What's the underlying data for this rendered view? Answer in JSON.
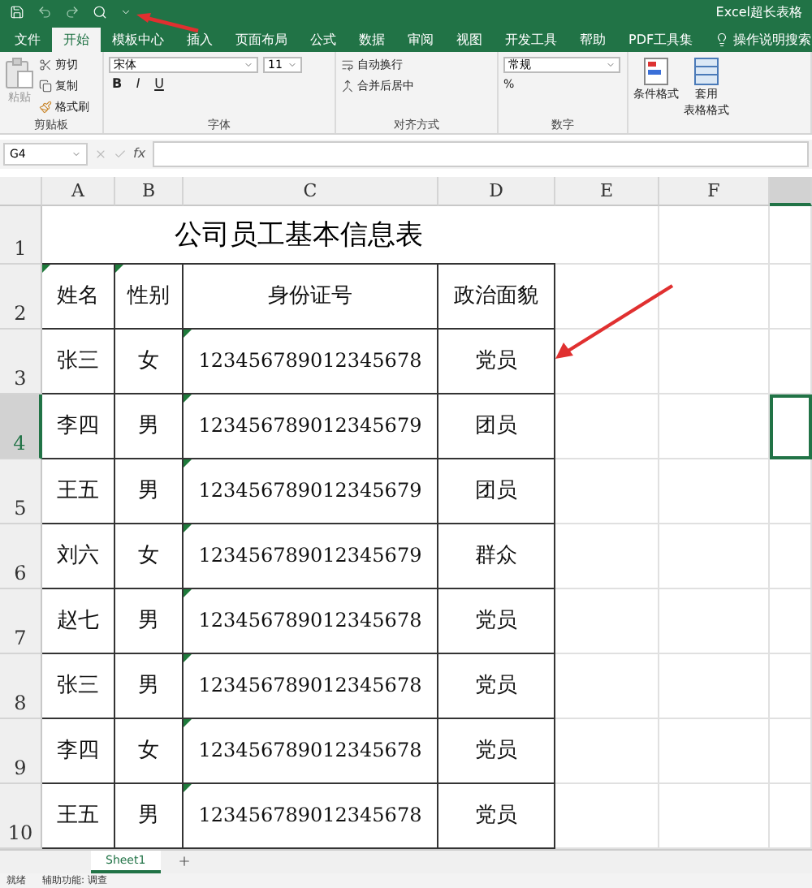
{
  "title_bar": {
    "title": "Excel超长表格"
  },
  "ribbon_tabs": [
    {
      "label": "文件",
      "selected": false
    },
    {
      "label": "开始",
      "selected": true
    },
    {
      "label": "模板中心",
      "selected": false
    },
    {
      "label": "插入",
      "selected": false
    },
    {
      "label": "页面布局",
      "selected": false
    },
    {
      "label": "公式",
      "selected": false
    },
    {
      "label": "数据",
      "selected": false
    },
    {
      "label": "审阅",
      "selected": false
    },
    {
      "label": "视图",
      "selected": false
    },
    {
      "label": "开发工具",
      "selected": false
    },
    {
      "label": "帮助",
      "selected": false
    },
    {
      "label": "PDF工具集",
      "selected": false
    }
  ],
  "tell_me": {
    "label": "操作说明搜索"
  },
  "ribbon": {
    "clipboard": {
      "label": "剪贴板",
      "paste": "粘贴",
      "paste_disabled": true,
      "cut": "剪切",
      "copy": "复制",
      "format_painter": "格式刷"
    },
    "font": {
      "label": "字体",
      "font_name": "宋体",
      "font_size": "11",
      "bold": "B",
      "italic": "I",
      "underline": "U"
    },
    "alignment": {
      "label": "对齐方式",
      "wrap": "自动换行",
      "merge": "合并后居中"
    },
    "number": {
      "label": "数字",
      "format": "常规",
      "percent": "%"
    },
    "styles": {
      "conditional": "条件格式",
      "table_format": [
        "套用",
        "表格格式"
      ]
    }
  },
  "formula_bar": {
    "name_box": "G4",
    "fx": "fx"
  },
  "sheet": {
    "columns": [
      {
        "label": "A",
        "selected": false
      },
      {
        "label": "B",
        "selected": false
      },
      {
        "label": "C",
        "selected": false
      },
      {
        "label": "D",
        "selected": false
      },
      {
        "label": "E",
        "selected": false
      },
      {
        "label": "F",
        "selected": false
      },
      {
        "selected": true
      }
    ],
    "title": "公司员工基本信息表",
    "header": [
      "姓名",
      "性别",
      "身份证号",
      "政治面貌"
    ],
    "rows": [
      {
        "number": "1",
        "selected": false
      },
      {
        "number": "2",
        "selected": false
      },
      {
        "number": "3",
        "selected": false,
        "cells": [
          "张三",
          "女",
          "123456789012345678",
          "党员"
        ]
      },
      {
        "number": "4",
        "selected": true,
        "cells": [
          "李四",
          "男",
          "123456789012345679",
          "团员"
        ]
      },
      {
        "number": "5",
        "selected": false,
        "cells": [
          "王五",
          "男",
          "123456789012345679",
          "团员"
        ]
      },
      {
        "number": "6",
        "selected": false,
        "cells": [
          "刘六",
          "女",
          "123456789012345679",
          "群众"
        ]
      },
      {
        "number": "7",
        "selected": false,
        "cells": [
          "赵七",
          "男",
          "123456789012345678",
          "党员"
        ]
      },
      {
        "number": "8",
        "selected": false,
        "cells": [
          "张三",
          "男",
          "123456789012345678",
          "党员"
        ]
      },
      {
        "number": "9",
        "selected": false,
        "cells": [
          "李四",
          "女",
          "123456789012345678",
          "党员"
        ]
      },
      {
        "number": "10",
        "selected": false,
        "cells": [
          "王五",
          "男",
          "123456789012345678",
          "党员"
        ]
      }
    ]
  },
  "sheet_tabs": [
    {
      "label": "Sheet1",
      "selected": true
    }
  ],
  "status_bar": {
    "ready": "就绪",
    "accessibility": "辅助功能: 调查"
  }
}
